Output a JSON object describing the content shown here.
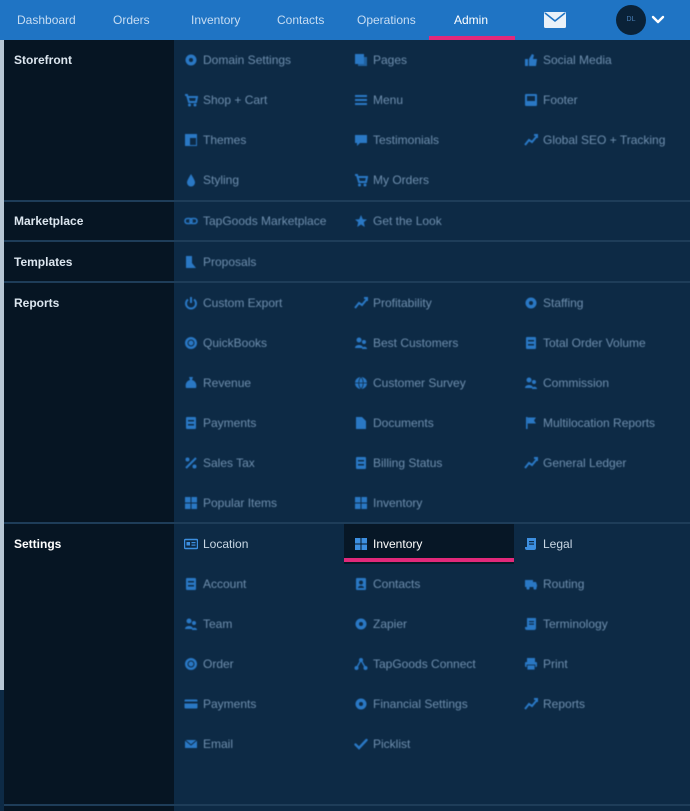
{
  "nav": {
    "items": [
      "Dashboard",
      "Orders",
      "Inventory",
      "Contacts",
      "Operations",
      "Admin"
    ],
    "active": "Admin",
    "avatar_initials": "DL",
    "accent": "#e2297a",
    "bar_color": "#1f74c4"
  },
  "sections": {
    "storefront": {
      "label": "Storefront",
      "items": [
        {
          "label": "Domain Settings",
          "icon": "gear-icon"
        },
        {
          "label": "Pages",
          "icon": "pages-icon"
        },
        {
          "label": "Social Media",
          "icon": "thumbs-up-icon"
        },
        {
          "label": "Shop + Cart",
          "icon": "cart-icon"
        },
        {
          "label": "Menu",
          "icon": "menu-icon"
        },
        {
          "label": "Footer",
          "icon": "footer-icon"
        },
        {
          "label": "Themes",
          "icon": "themes-icon"
        },
        {
          "label": "Testimonials",
          "icon": "comment-icon"
        },
        {
          "label": "Global SEO + Tracking",
          "icon": "trend-icon"
        },
        {
          "label": "Styling",
          "icon": "drop-icon"
        },
        {
          "label": "My Orders",
          "icon": "cart-icon"
        }
      ]
    },
    "marketplace": {
      "label": "Marketplace",
      "items": [
        {
          "label": "TapGoods Marketplace",
          "icon": "link-icon"
        },
        {
          "label": "Get the Look",
          "icon": "star-icon"
        }
      ]
    },
    "templates": {
      "label": "Templates",
      "items": [
        {
          "label": "Proposals",
          "icon": "proposal-icon"
        }
      ]
    },
    "reports": {
      "label": "Reports",
      "items": [
        {
          "label": "Custom Export",
          "icon": "power-icon"
        },
        {
          "label": "Profitability",
          "icon": "trend-icon"
        },
        {
          "label": "Staffing",
          "icon": "gear-icon"
        },
        {
          "label": "QuickBooks",
          "icon": "circle-icon"
        },
        {
          "label": "Best Customers",
          "icon": "users-icon"
        },
        {
          "label": "Total Order Volume",
          "icon": "doc-icon"
        },
        {
          "label": "Revenue",
          "icon": "money-bag-icon"
        },
        {
          "label": "Customer Survey",
          "icon": "globe-icon"
        },
        {
          "label": "Commission",
          "icon": "users-icon"
        },
        {
          "label": "Payments",
          "icon": "doc-icon"
        },
        {
          "label": "Documents",
          "icon": "file-icon"
        },
        {
          "label": "Multilocation Reports",
          "icon": "flag-icon"
        },
        {
          "label": "Sales Tax",
          "icon": "percent-icon"
        },
        {
          "label": "Billing Status",
          "icon": "doc-icon"
        },
        {
          "label": "General Ledger",
          "icon": "trend-icon"
        },
        {
          "label": "Popular Items",
          "icon": "grid-icon"
        },
        {
          "label": "Inventory",
          "icon": "grid-icon"
        }
      ]
    },
    "settings": {
      "label": "Settings",
      "items": [
        {
          "label": "Location",
          "icon": "id-card-icon"
        },
        {
          "label": "Inventory",
          "icon": "grid-icon"
        },
        {
          "label": "Legal",
          "icon": "scroll-icon"
        },
        {
          "label": "Account",
          "icon": "doc-icon"
        },
        {
          "label": "Contacts",
          "icon": "contact-icon"
        },
        {
          "label": "Routing",
          "icon": "truck-icon"
        },
        {
          "label": "Team",
          "icon": "users-icon"
        },
        {
          "label": "Zapier",
          "icon": "gear-icon"
        },
        {
          "label": "Terminology",
          "icon": "scroll-icon"
        },
        {
          "label": "Order",
          "icon": "circle-icon"
        },
        {
          "label": "TapGoods Connect",
          "icon": "network-icon"
        },
        {
          "label": "Print",
          "icon": "print-icon"
        },
        {
          "label": "Payments",
          "icon": "card-icon"
        },
        {
          "label": "Financial Settings",
          "icon": "gear-icon"
        },
        {
          "label": "Reports",
          "icon": "trend-icon"
        },
        {
          "label": "Email",
          "icon": "envelope-icon"
        },
        {
          "label": "Picklist",
          "icon": "check-icon"
        }
      ]
    }
  }
}
